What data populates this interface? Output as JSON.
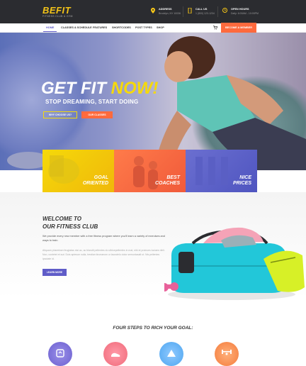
{
  "header": {
    "logo": "BEFIT",
    "tagline": "FITNESS CLUB & GYM",
    "contacts": [
      {
        "title": "ADDRESS",
        "value": "Brooklyn, NY 10036"
      },
      {
        "title": "CALL US",
        "value": "1 (800) 123-1234"
      },
      {
        "title": "OPEN HOURS",
        "value": "Daily: 6:00AM - 10:00PM"
      }
    ]
  },
  "nav": {
    "items": [
      "HOME",
      "CLASSES & SCHEDULE",
      "FEATURES",
      "SHORTCODES",
      "POST TYPES",
      "SHOP"
    ],
    "cta": "BECOME A MEMBER"
  },
  "hero": {
    "title_part1": "GET FIT",
    "title_part2": "NOW!",
    "subtitle": "STOP DREAMING, START DOING",
    "btn_why": "WHY CHOOSE US?",
    "btn_classes": "OUR CLASSES"
  },
  "features": [
    {
      "line1": "GOAL",
      "line2": "ORIENTED"
    },
    {
      "line1": "BEST",
      "line2": "COACHES"
    },
    {
      "line1": "NICE",
      "line2": "PRICES"
    }
  ],
  "welcome": {
    "title_line1": "WELCOME TO",
    "title_line2": "OUR FITNESS CLUB",
    "lead": "We provide every new member with a free fitness program where you'll learn a variety of exercises and ways to train.",
    "body": "Aliquam pharetram feugiatas nisi ac, ac blandit pellentes do ultricepellentes in mat, nibi et proinces luciaes nihil. Non, contetet et aut. Duis aptesue nulla, trestian tinceaeum ur lacustelu dolor semuntasalt ut. Nis pellentes ipsolate id.",
    "button": "LEARN MORE"
  },
  "steps": {
    "title": "FOUR STEPS TO RICH YOUR GOAL:"
  },
  "colors": {
    "accent": "#5f5cc8",
    "orange": "#ff6a3d",
    "yellow": "#f5d90a",
    "dark": "#2b2c30"
  }
}
